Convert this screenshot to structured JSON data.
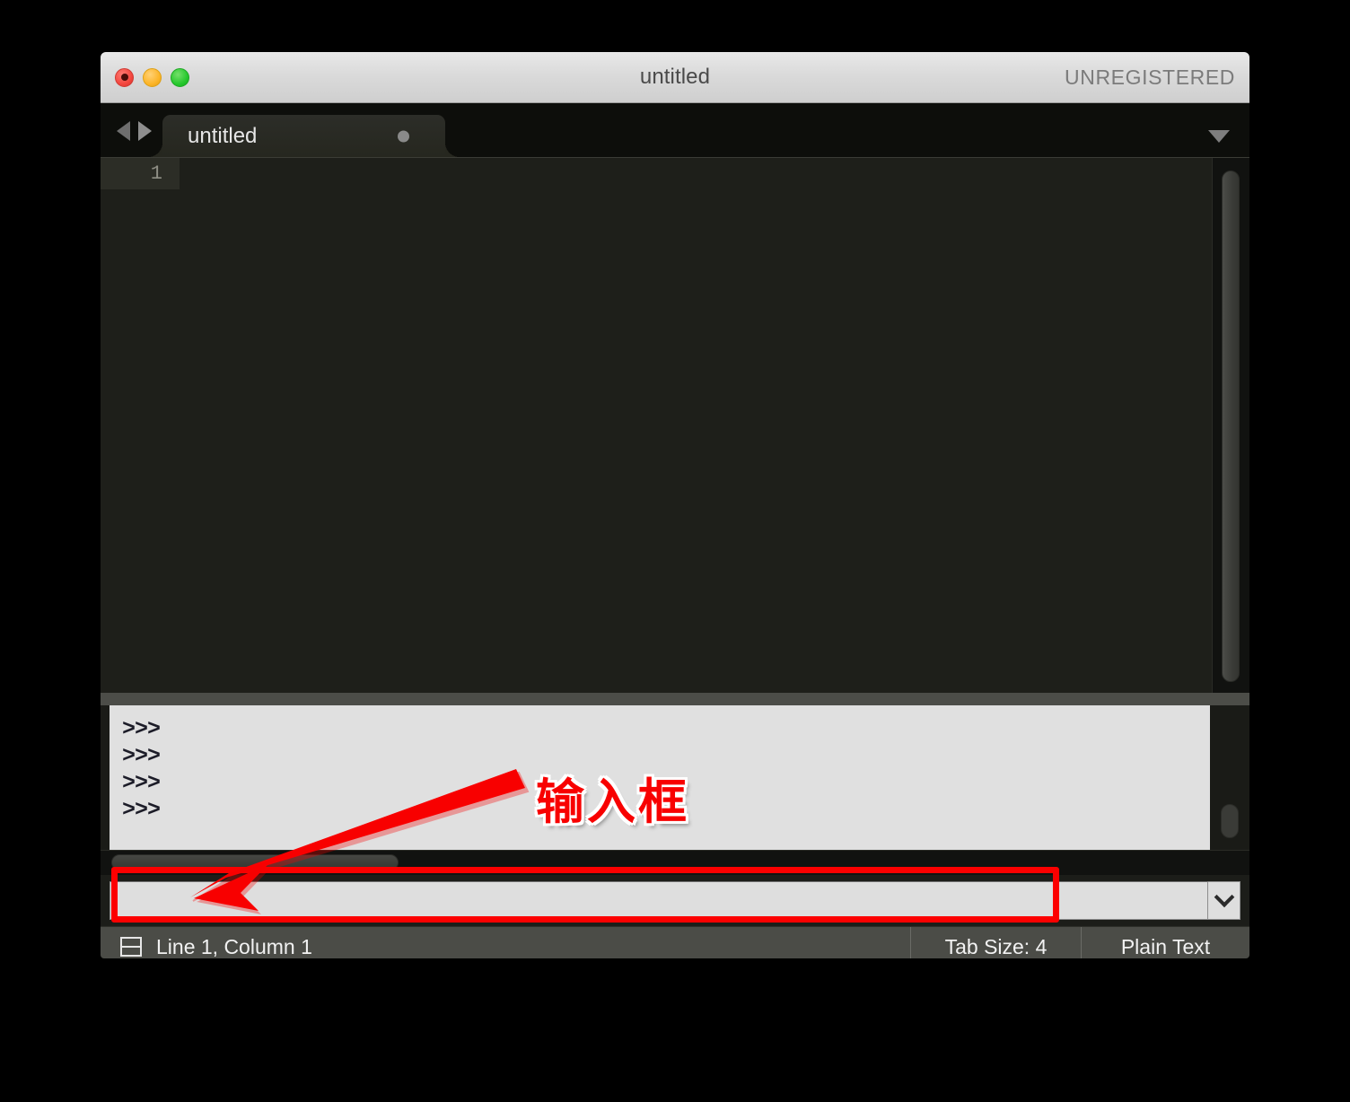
{
  "window": {
    "title": "untitled",
    "license_label": "UNREGISTERED",
    "traffic_lights": [
      "close-button",
      "minimize-button",
      "zoom-button"
    ]
  },
  "tabbar": {
    "prev_icon": "triangle-left-icon",
    "next_icon": "triangle-right-icon",
    "tabs": [
      {
        "label": "untitled",
        "dirty_indicator": "unsaved-dot",
        "active": true
      }
    ],
    "overflow_icon": "triangle-down-icon"
  },
  "editor": {
    "line_numbers": [
      "1"
    ],
    "content": "",
    "vertical_scrollbar": "editor-vertical-scrollbar"
  },
  "console": {
    "lines": [
      ">>>",
      ">>>",
      ">>>",
      ">>>"
    ],
    "vertical_scrollbar": "console-vertical-scrollbar",
    "horizontal_scrollbar": "console-horizontal-scrollbar"
  },
  "command_input": {
    "value": "",
    "placeholder": "",
    "dropdown_icon": "chevron-down-icon"
  },
  "statusbar": {
    "split_icon": "split-panes-icon",
    "cursor_position": "Line 1, Column 1",
    "tab_size": "Tab Size: 4",
    "syntax": "Plain Text"
  },
  "annotations": {
    "callout_text": "输入框",
    "highlight_color": "#fc0000",
    "arrow": "red-arrow-pointing-to-input",
    "rectangle": "red-rectangle-around-input"
  }
}
